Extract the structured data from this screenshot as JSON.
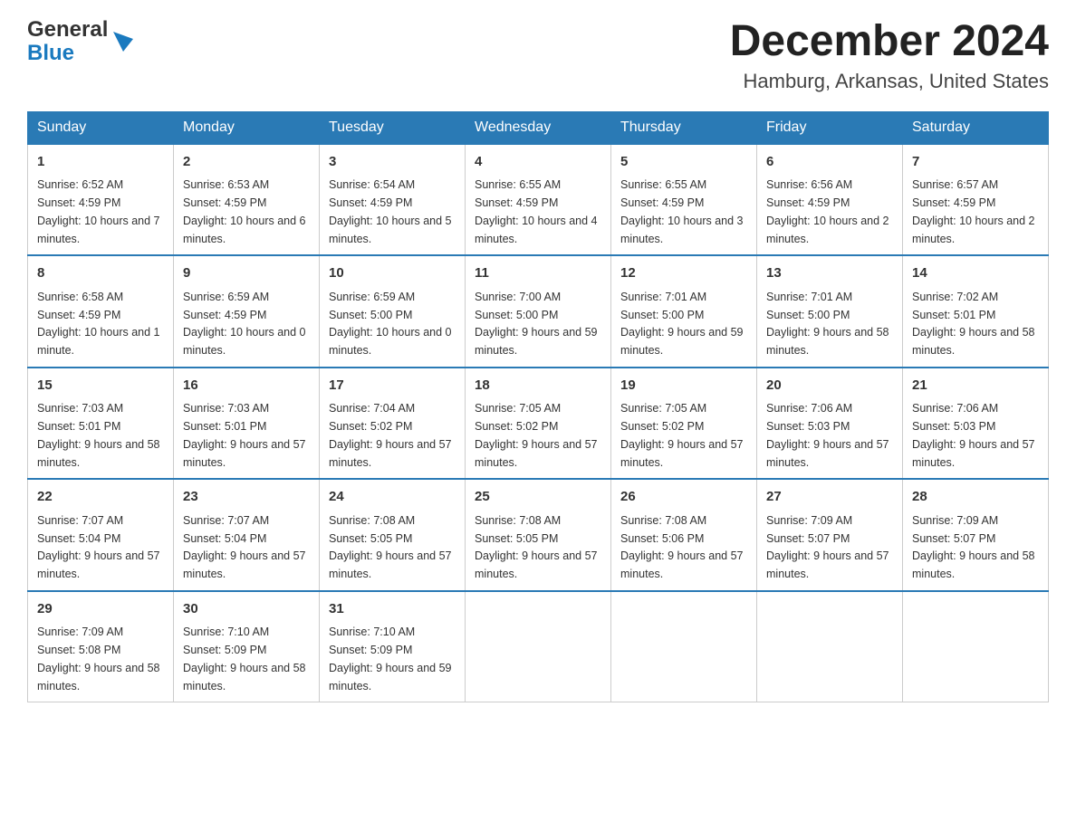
{
  "header": {
    "logo_general": "General",
    "logo_blue": "Blue",
    "month_year": "December 2024",
    "location": "Hamburg, Arkansas, United States"
  },
  "days_of_week": [
    "Sunday",
    "Monday",
    "Tuesday",
    "Wednesday",
    "Thursday",
    "Friday",
    "Saturday"
  ],
  "weeks": [
    [
      {
        "day": "1",
        "sunrise": "6:52 AM",
        "sunset": "4:59 PM",
        "daylight": "10 hours and 7 minutes."
      },
      {
        "day": "2",
        "sunrise": "6:53 AM",
        "sunset": "4:59 PM",
        "daylight": "10 hours and 6 minutes."
      },
      {
        "day": "3",
        "sunrise": "6:54 AM",
        "sunset": "4:59 PM",
        "daylight": "10 hours and 5 minutes."
      },
      {
        "day": "4",
        "sunrise": "6:55 AM",
        "sunset": "4:59 PM",
        "daylight": "10 hours and 4 minutes."
      },
      {
        "day": "5",
        "sunrise": "6:55 AM",
        "sunset": "4:59 PM",
        "daylight": "10 hours and 3 minutes."
      },
      {
        "day": "6",
        "sunrise": "6:56 AM",
        "sunset": "4:59 PM",
        "daylight": "10 hours and 2 minutes."
      },
      {
        "day": "7",
        "sunrise": "6:57 AM",
        "sunset": "4:59 PM",
        "daylight": "10 hours and 2 minutes."
      }
    ],
    [
      {
        "day": "8",
        "sunrise": "6:58 AM",
        "sunset": "4:59 PM",
        "daylight": "10 hours and 1 minute."
      },
      {
        "day": "9",
        "sunrise": "6:59 AM",
        "sunset": "4:59 PM",
        "daylight": "10 hours and 0 minutes."
      },
      {
        "day": "10",
        "sunrise": "6:59 AM",
        "sunset": "5:00 PM",
        "daylight": "10 hours and 0 minutes."
      },
      {
        "day": "11",
        "sunrise": "7:00 AM",
        "sunset": "5:00 PM",
        "daylight": "9 hours and 59 minutes."
      },
      {
        "day": "12",
        "sunrise": "7:01 AM",
        "sunset": "5:00 PM",
        "daylight": "9 hours and 59 minutes."
      },
      {
        "day": "13",
        "sunrise": "7:01 AM",
        "sunset": "5:00 PM",
        "daylight": "9 hours and 58 minutes."
      },
      {
        "day": "14",
        "sunrise": "7:02 AM",
        "sunset": "5:01 PM",
        "daylight": "9 hours and 58 minutes."
      }
    ],
    [
      {
        "day": "15",
        "sunrise": "7:03 AM",
        "sunset": "5:01 PM",
        "daylight": "9 hours and 58 minutes."
      },
      {
        "day": "16",
        "sunrise": "7:03 AM",
        "sunset": "5:01 PM",
        "daylight": "9 hours and 57 minutes."
      },
      {
        "day": "17",
        "sunrise": "7:04 AM",
        "sunset": "5:02 PM",
        "daylight": "9 hours and 57 minutes."
      },
      {
        "day": "18",
        "sunrise": "7:05 AM",
        "sunset": "5:02 PM",
        "daylight": "9 hours and 57 minutes."
      },
      {
        "day": "19",
        "sunrise": "7:05 AM",
        "sunset": "5:02 PM",
        "daylight": "9 hours and 57 minutes."
      },
      {
        "day": "20",
        "sunrise": "7:06 AM",
        "sunset": "5:03 PM",
        "daylight": "9 hours and 57 minutes."
      },
      {
        "day": "21",
        "sunrise": "7:06 AM",
        "sunset": "5:03 PM",
        "daylight": "9 hours and 57 minutes."
      }
    ],
    [
      {
        "day": "22",
        "sunrise": "7:07 AM",
        "sunset": "5:04 PM",
        "daylight": "9 hours and 57 minutes."
      },
      {
        "day": "23",
        "sunrise": "7:07 AM",
        "sunset": "5:04 PM",
        "daylight": "9 hours and 57 minutes."
      },
      {
        "day": "24",
        "sunrise": "7:08 AM",
        "sunset": "5:05 PM",
        "daylight": "9 hours and 57 minutes."
      },
      {
        "day": "25",
        "sunrise": "7:08 AM",
        "sunset": "5:05 PM",
        "daylight": "9 hours and 57 minutes."
      },
      {
        "day": "26",
        "sunrise": "7:08 AM",
        "sunset": "5:06 PM",
        "daylight": "9 hours and 57 minutes."
      },
      {
        "day": "27",
        "sunrise": "7:09 AM",
        "sunset": "5:07 PM",
        "daylight": "9 hours and 57 minutes."
      },
      {
        "day": "28",
        "sunrise": "7:09 AM",
        "sunset": "5:07 PM",
        "daylight": "9 hours and 58 minutes."
      }
    ],
    [
      {
        "day": "29",
        "sunrise": "7:09 AM",
        "sunset": "5:08 PM",
        "daylight": "9 hours and 58 minutes."
      },
      {
        "day": "30",
        "sunrise": "7:10 AM",
        "sunset": "5:09 PM",
        "daylight": "9 hours and 58 minutes."
      },
      {
        "day": "31",
        "sunrise": "7:10 AM",
        "sunset": "5:09 PM",
        "daylight": "9 hours and 59 minutes."
      },
      null,
      null,
      null,
      null
    ]
  ],
  "labels": {
    "sunrise": "Sunrise:",
    "sunset": "Sunset:",
    "daylight": "Daylight:"
  }
}
